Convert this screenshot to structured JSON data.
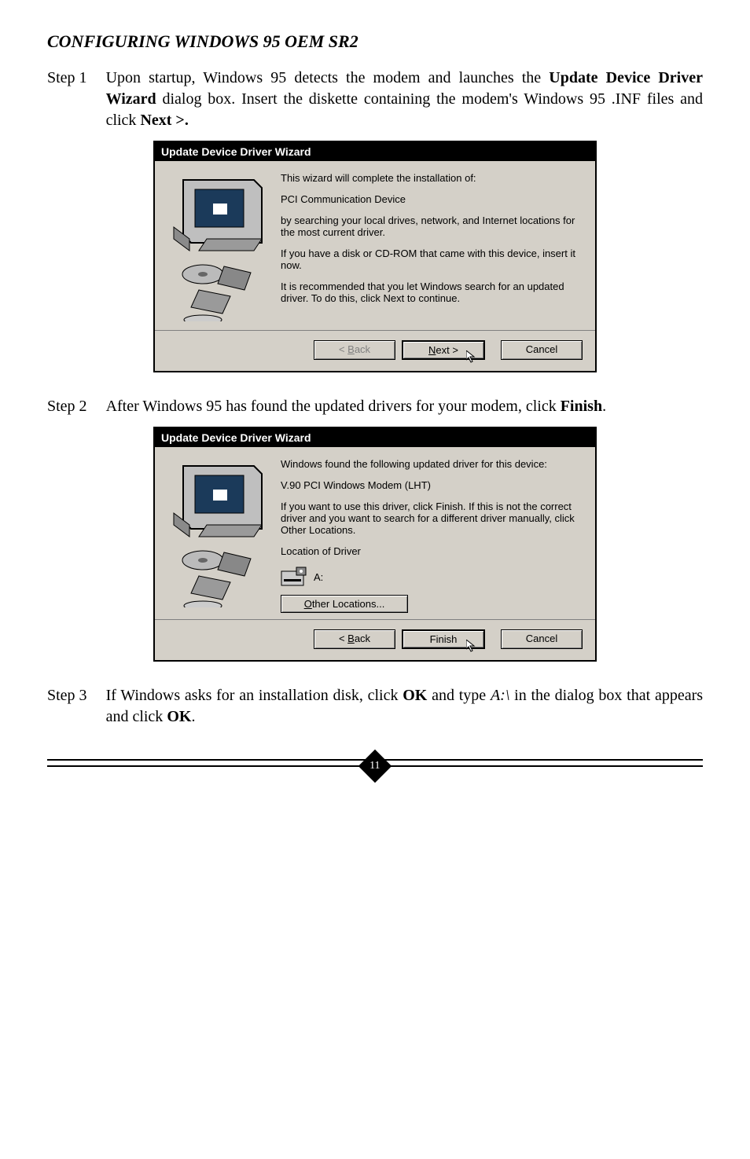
{
  "heading": "CONFIGURING WINDOWS 95 OEM SR2",
  "step1": {
    "label": "Step 1",
    "t1": "Upon startup, Windows 95 detects the modem and launches the ",
    "b1": "Update Device Driver Wizard",
    "t2": " dialog box. Insert the diskette containing the modem's Windows 95 .INF files and click ",
    "b2": "Next >."
  },
  "dlg1": {
    "title": "Update Device Driver Wizard",
    "l1": "This wizard will complete the installation of:",
    "l2": "PCI Communication Device",
    "l3": "by searching your local drives, network, and Internet locations for the most current driver.",
    "l4": "If you have a disk or CD-ROM that came with this device, insert it now.",
    "l5": "It is recommended that you let Windows search for an updated driver. To do this, click Next to continue.",
    "back_pre": "< ",
    "back_u": "B",
    "back_post": "ack",
    "next_u": "N",
    "next_post": "ext >",
    "cancel": "Cancel"
  },
  "step2": {
    "label": "Step 2",
    "t1": "After Windows 95 has found the updated drivers for your modem, click ",
    "b1": "Finish",
    "t2": "."
  },
  "dlg2": {
    "title": "Update Device Driver Wizard",
    "l1": "Windows found the following updated driver for this device:",
    "l2": "V.90 PCI Windows Modem (LHT)",
    "l3": "If you want to use this driver, click Finish. If this is not the correct driver and you want to search for a different driver manually, click Other Locations.",
    "l4": "Location of Driver",
    "drive": "A:",
    "other_u": "O",
    "other_post": "ther Locations...",
    "back_pre": "< ",
    "back_u": "B",
    "back_post": "ack",
    "finish": "Finish",
    "cancel": "Cancel"
  },
  "step3": {
    "label": "Step 3",
    "t1": "If Windows asks for an installation disk, click ",
    "b1": "OK",
    "t2": " and type ",
    "i1": "A:\\",
    "t3": " in the dialog box that appears and click ",
    "b2": "OK",
    "t4": "."
  },
  "page_number": "11"
}
